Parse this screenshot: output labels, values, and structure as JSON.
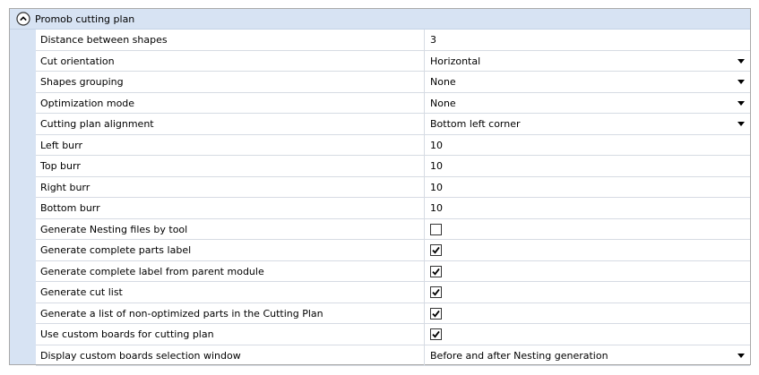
{
  "category": {
    "title": "Promob cutting plan",
    "expanded": true,
    "toggle_icon": "chevron-up-circle-icon"
  },
  "properties": [
    {
      "name": "Distance between shapes",
      "kind": "text",
      "value": "3"
    },
    {
      "name": "Cut orientation",
      "kind": "dropdown",
      "value": "Horizontal"
    },
    {
      "name": "Shapes grouping",
      "kind": "dropdown",
      "value": "None"
    },
    {
      "name": "Optimization mode",
      "kind": "dropdown",
      "value": "None"
    },
    {
      "name": "Cutting plan alignment",
      "kind": "dropdown",
      "value": "Bottom left corner"
    },
    {
      "name": "Left burr",
      "kind": "text",
      "value": "10"
    },
    {
      "name": "Top burr",
      "kind": "text",
      "value": "10"
    },
    {
      "name": "Right burr",
      "kind": "text",
      "value": "10"
    },
    {
      "name": "Bottom burr",
      "kind": "text",
      "value": "10"
    },
    {
      "name": "Generate Nesting files by tool",
      "kind": "checkbox",
      "checked": false
    },
    {
      "name": "Generate complete parts label",
      "kind": "checkbox",
      "checked": true
    },
    {
      "name": "Generate complete label from parent module",
      "kind": "checkbox",
      "checked": true
    },
    {
      "name": "Generate cut list",
      "kind": "checkbox",
      "checked": true
    },
    {
      "name": "Generate a list of non-optimized parts in the Cutting Plan",
      "kind": "checkbox",
      "checked": true
    },
    {
      "name": "Use custom boards for cutting plan",
      "kind": "checkbox",
      "checked": true
    },
    {
      "name": "Display custom boards selection window",
      "kind": "dropdown",
      "value": "Before and after Nesting generation"
    }
  ],
  "colors": {
    "category_background": "#d7e3f3",
    "grid_line": "#d6dbe3",
    "border": "#a9a9a9"
  }
}
